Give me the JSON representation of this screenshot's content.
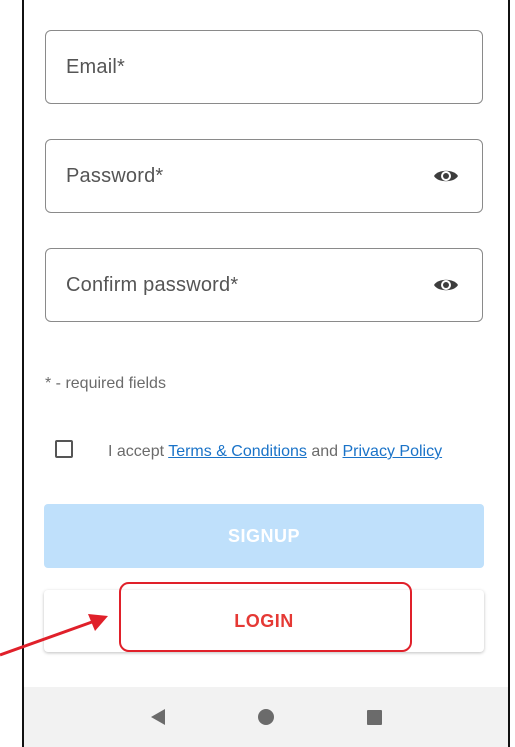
{
  "form": {
    "email_label": "Email*",
    "password_label": "Password*",
    "confirm_password_label": "Confirm password*",
    "required_note": "* - required fields"
  },
  "terms": {
    "prefix": "I accept ",
    "terms_link": "Terms & Conditions",
    "middle": " and ",
    "privacy_link": "Privacy Policy",
    "checked": false
  },
  "buttons": {
    "signup_label": "SIGNUP",
    "login_label": "LOGIN"
  },
  "nav": {
    "back_icon": "triangle-left",
    "home_icon": "circle",
    "recents_icon": "square"
  },
  "colors": {
    "signup_disabled_bg": "#bfe0fb",
    "login_text": "#e53935",
    "link": "#1a73c8",
    "annotation": "#e0202a"
  }
}
